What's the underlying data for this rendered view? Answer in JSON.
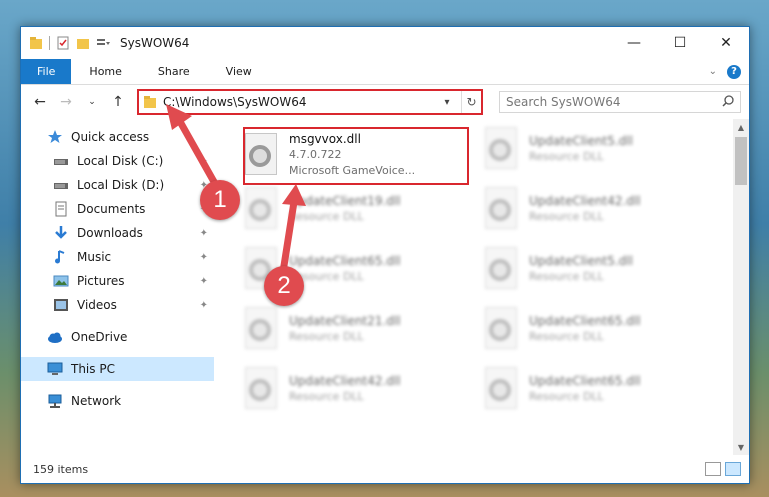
{
  "window": {
    "title": "SysWOW64",
    "controls": {
      "minimize": "—",
      "maximize": "☐",
      "close": "✕"
    }
  },
  "ribbon": {
    "tabs": [
      "File",
      "Home",
      "Share",
      "View"
    ]
  },
  "navigation": {
    "address": "C:\\Windows\\SysWOW64",
    "search_placeholder": "Search SysWOW64"
  },
  "sidebar": {
    "items": [
      {
        "label": "Quick access"
      },
      {
        "label": "Local Disk (C:)"
      },
      {
        "label": "Local Disk (D:)"
      },
      {
        "label": "Documents"
      },
      {
        "label": "Downloads"
      },
      {
        "label": "Music"
      },
      {
        "label": "Pictures"
      },
      {
        "label": "Videos"
      },
      {
        "label": "OneDrive"
      },
      {
        "label": "This PC"
      },
      {
        "label": "Network"
      }
    ]
  },
  "files": [
    {
      "name": "msgvvox.dll",
      "line2": "4.7.0.722",
      "line3": "Microsoft GameVoice..."
    },
    {
      "name": "UpdateClient5.dll",
      "line2": "Resource DLL"
    },
    {
      "name": "UpdateClient19.dll",
      "line2": "Resource DLL"
    },
    {
      "name": "UpdateClient42.dll",
      "line2": "Resource DLL"
    },
    {
      "name": "UpdateClient65.dll",
      "line2": "Resource DLL"
    },
    {
      "name": "UpdateClient5.dll",
      "line2": "Resource DLL"
    },
    {
      "name": "UpdateClient21.dll",
      "line2": "Resource DLL"
    },
    {
      "name": "UpdateClient65.dll",
      "line2": "Resource DLL"
    },
    {
      "name": "UpdateClient42.dll",
      "line2": "Resource DLL"
    },
    {
      "name": "UpdateClient65.dll",
      "line2": "Resource DLL"
    }
  ],
  "status": {
    "item_count": "159 items"
  },
  "annotations": {
    "step1": "1",
    "step2": "2",
    "color": "#e04b4f"
  }
}
